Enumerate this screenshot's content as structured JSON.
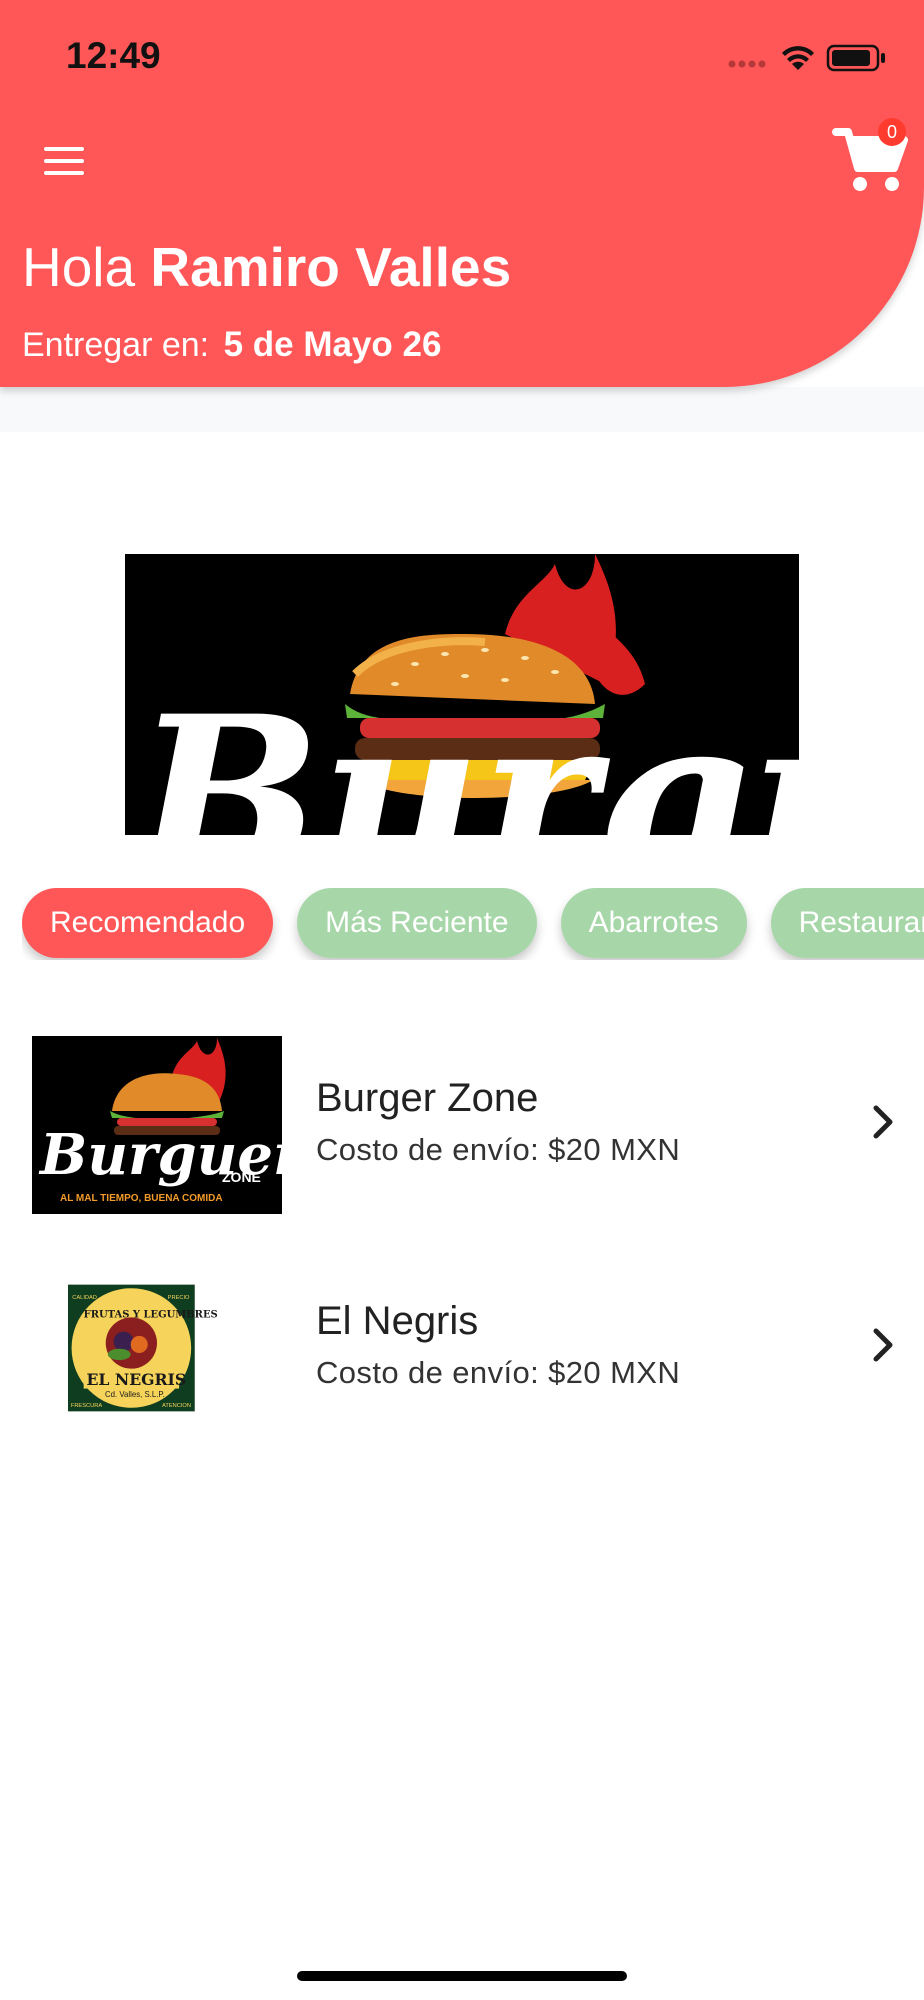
{
  "status_bar": {
    "time": "12:49"
  },
  "header": {
    "greeting": "Hola",
    "user_name": "Ramiro Valles",
    "deliver_label": "Entregar en:",
    "deliver_address": "5 de Mayo 26",
    "cart_count": "0",
    "accent_color": "#ff5757"
  },
  "banner": {
    "brand_text": "Burguer"
  },
  "categories": [
    {
      "label": "Recomendado",
      "active": true
    },
    {
      "label": "Más Reciente",
      "active": false
    },
    {
      "label": "Abarrotes",
      "active": false
    },
    {
      "label": "Restaurantes",
      "active": false
    }
  ],
  "stores": [
    {
      "name": "Burger Zone",
      "fee": "Costo de envío: $20 MXN",
      "logo": {
        "brand": "Burguer",
        "sub": "ZONE",
        "tagline": "AL MAL TIEMPO, BUENA COMIDA"
      }
    },
    {
      "name": "El Negris",
      "fee": "Costo de envío: $20 MXN",
      "logo": {
        "top": "FRUTAS Y LEGUMBRES",
        "brand": "EL NEGRIS",
        "place": "Cd. Valles, S.L.P.",
        "c1": "CALIDAD",
        "c2": "PRECIO",
        "c3": "FRESCURA",
        "c4": "ATENCION"
      }
    }
  ]
}
